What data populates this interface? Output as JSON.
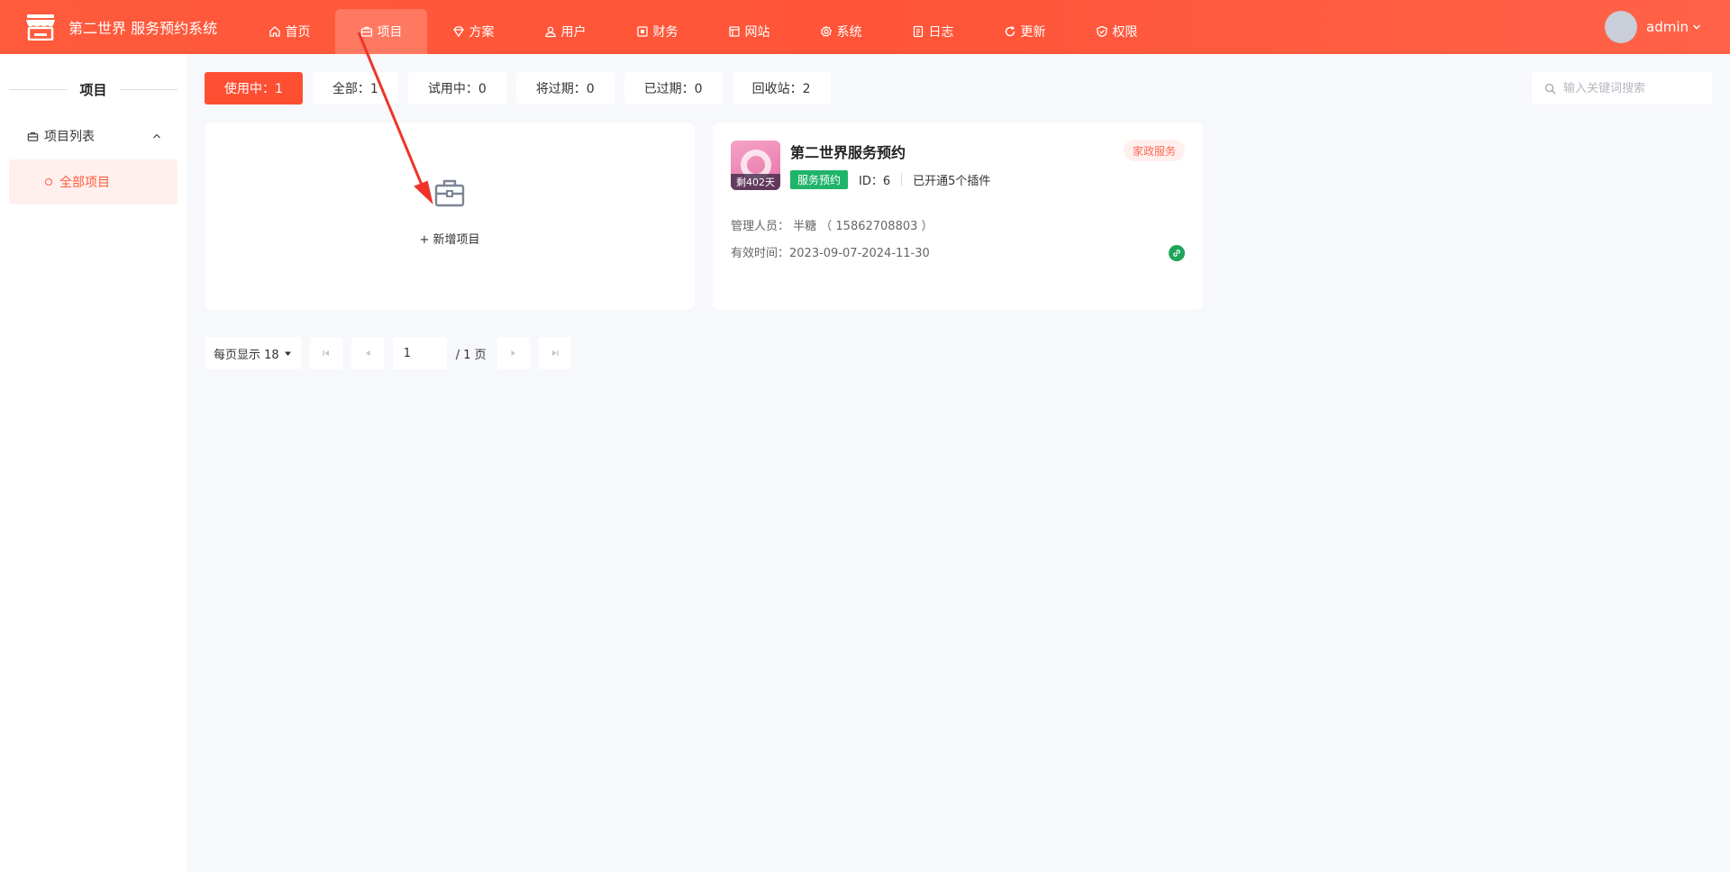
{
  "app": {
    "title": "第二世界 服务预约系统",
    "logo_icon": "store-icon"
  },
  "nav": {
    "active": "项目",
    "items": [
      {
        "label": "首页",
        "icon": "home-icon"
      },
      {
        "label": "项目",
        "icon": "briefcase-icon"
      },
      {
        "label": "方案",
        "icon": "diamond-icon"
      },
      {
        "label": "用户",
        "icon": "users-icon"
      },
      {
        "label": "财务",
        "icon": "finance-icon"
      },
      {
        "label": "网站",
        "icon": "website-icon"
      },
      {
        "label": "系统",
        "icon": "gear-icon"
      },
      {
        "label": "日志",
        "icon": "log-icon"
      },
      {
        "label": "更新",
        "icon": "refresh-icon"
      },
      {
        "label": "权限",
        "icon": "shield-icon"
      }
    ]
  },
  "user": {
    "name": "admin"
  },
  "sidebar": {
    "heading": "项目",
    "group_label": "项目列表",
    "item_label": "全部项目"
  },
  "filters": {
    "tabs": [
      {
        "label": "使用中：1",
        "active": true
      },
      {
        "label": "全部：1",
        "active": false
      },
      {
        "label": "试用中：0",
        "active": false
      },
      {
        "label": "将过期：0",
        "active": false
      },
      {
        "label": "已过期：0",
        "active": false
      },
      {
        "label": "回收站：2",
        "active": false
      }
    ],
    "search_placeholder": "输入关键词搜索"
  },
  "add_card": {
    "label": "+ 新增项目"
  },
  "project": {
    "name": "第二世界服务预约",
    "days_left": "剩402天",
    "category": "家政服务",
    "tag": "服务预约",
    "id_text": "ID：6",
    "plugins_text": "已开通5个插件",
    "manager_text": "管理人员： 半糖 （ 15862708803 ）",
    "valid_text": "有效时间：2023-09-07-2024-11-30"
  },
  "pagination": {
    "page_size_label": "每页显示 18",
    "current_page": "1",
    "total_label": "/ 1 页"
  },
  "colors": {
    "accent": "#ff5a3c",
    "tag_green": "#1fb469",
    "annotation_red": "#f0342a"
  }
}
